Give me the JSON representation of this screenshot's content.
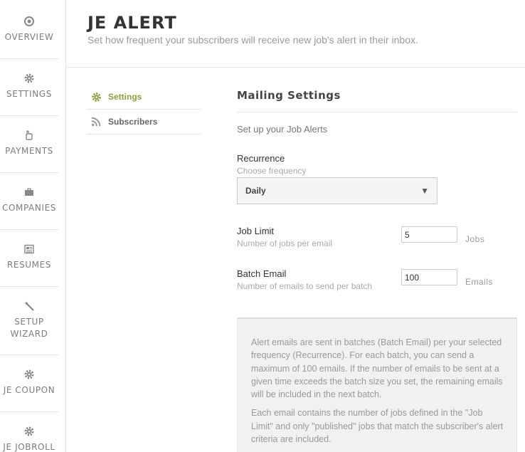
{
  "nav": {
    "items": [
      {
        "label": "OVERVIEW",
        "icon": "target-icon"
      },
      {
        "label": "SETTINGS",
        "icon": "gear-icon"
      },
      {
        "label": "PAYMENTS",
        "icon": "hand-icon"
      },
      {
        "label": "COMPANIES",
        "icon": "briefcase-icon"
      },
      {
        "label": "RESUMES",
        "icon": "newspaper-icon"
      },
      {
        "label": "SETUP",
        "label2": "WIZARD",
        "icon": "magic-wand-icon"
      },
      {
        "label": "JE COUPON",
        "icon": "gear-icon"
      },
      {
        "label": "JE JOBROLL",
        "icon": "gear-icon"
      }
    ]
  },
  "header": {
    "title": "JE ALERT",
    "subtitle": "Set how frequent your subscribers will receive new job's alert in their inbox."
  },
  "submenu": {
    "items": [
      {
        "label": "Settings",
        "icon": "gear-icon",
        "active": true
      },
      {
        "label": "Subscribers",
        "icon": "rss-icon",
        "active": false
      }
    ]
  },
  "main": {
    "title": "Mailing Settings",
    "description": "Set up your Job Alerts",
    "recurrence": {
      "label": "Recurrence",
      "hint": "Choose frequency",
      "selected": "Daily"
    },
    "job_limit": {
      "label": "Job Limit",
      "hint": "Number of jobs per email",
      "value": "5",
      "unit": "Jobs"
    },
    "batch_email": {
      "label": "Batch Email",
      "hint": "Number of emails to send per batch",
      "value": "100",
      "unit": "Emails"
    },
    "info": {
      "paragraph1": "Alert emails are sent in batches (Batch Email) per your selected frequency (Recurrence). For each batch, you can send a maximum of 100 emails. If the number of emails to be sent at a given time exceeds the batch size you set, the remaining emails will be included in the next batch.",
      "paragraph2": "Each email contains the number of jobs defined in the \"Job Limit\" and only \"published\" jobs that match the subscriber's alert criteria are included."
    }
  },
  "colors": {
    "accent": "#8aa03c",
    "nav_text": "#7c7c7c",
    "title": "#333333"
  }
}
